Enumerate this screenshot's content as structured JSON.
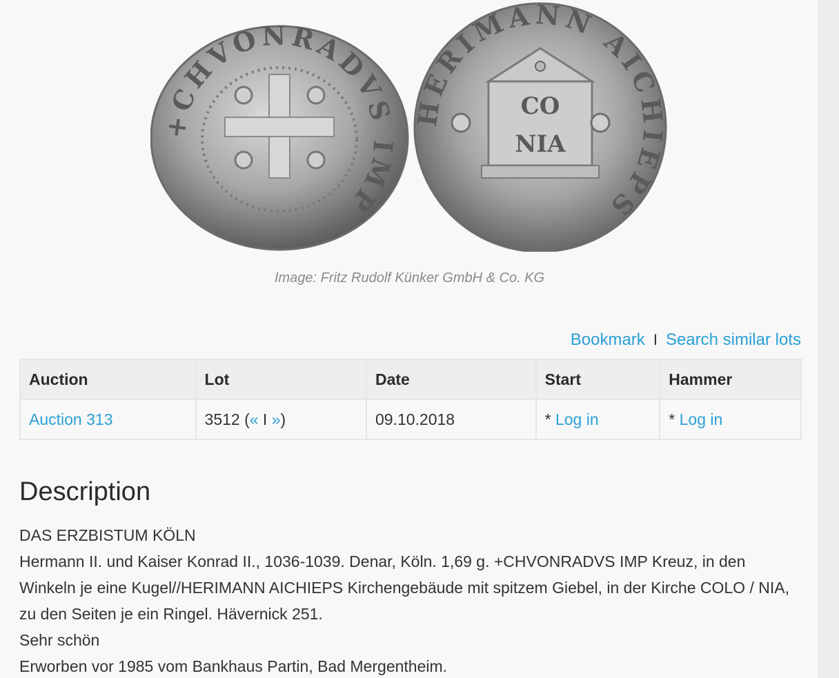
{
  "image_caption": "Image: Fritz Rudolf Künker GmbH & Co. KG",
  "actions": {
    "bookmark": "Bookmark",
    "separator": "I",
    "search_similar": "Search similar lots"
  },
  "table": {
    "headers": [
      "Auction",
      "Lot",
      "Date",
      "Start",
      "Hammer"
    ],
    "row": {
      "auction": "Auction 313",
      "lot_number": "3512 (",
      "prev": "«",
      "lot_sep": " I ",
      "next": "»",
      "lot_close": ")",
      "date": "09.10.2018",
      "start_prefix": "* ",
      "start_login": "Log in",
      "hammer_prefix": "* ",
      "hammer_login": "Log in"
    }
  },
  "description": {
    "heading": "Description",
    "lines": [
      "DAS ERZBISTUM KÖLN",
      "Hermann II. und Kaiser Konrad II., 1036-1039. Denar, Köln. 1,69 g. +CHVONRADVS IMP Kreuz, in den Winkeln je eine Kugel//HERIMANN AICHIEPS Kirchengebäude mit spitzem Giebel, in der Kirche COLO / NIA, zu den Seiten je ein Ringel. Hävernick 251.",
      "Sehr schön",
      "Erworben vor 1985 vom Bankhaus Partin, Bad Mergentheim."
    ]
  },
  "coins": {
    "obverse_letters": "+CHVONRADVS IMP",
    "reverse_letters": "HERIMANN AICHIEPS",
    "reverse_center_top": "CO",
    "reverse_center_bottom": "NIA"
  },
  "colors": {
    "link": "#2a9fd6",
    "header_bg": "#eeeeee",
    "page_bg": "#f8f8f8"
  }
}
